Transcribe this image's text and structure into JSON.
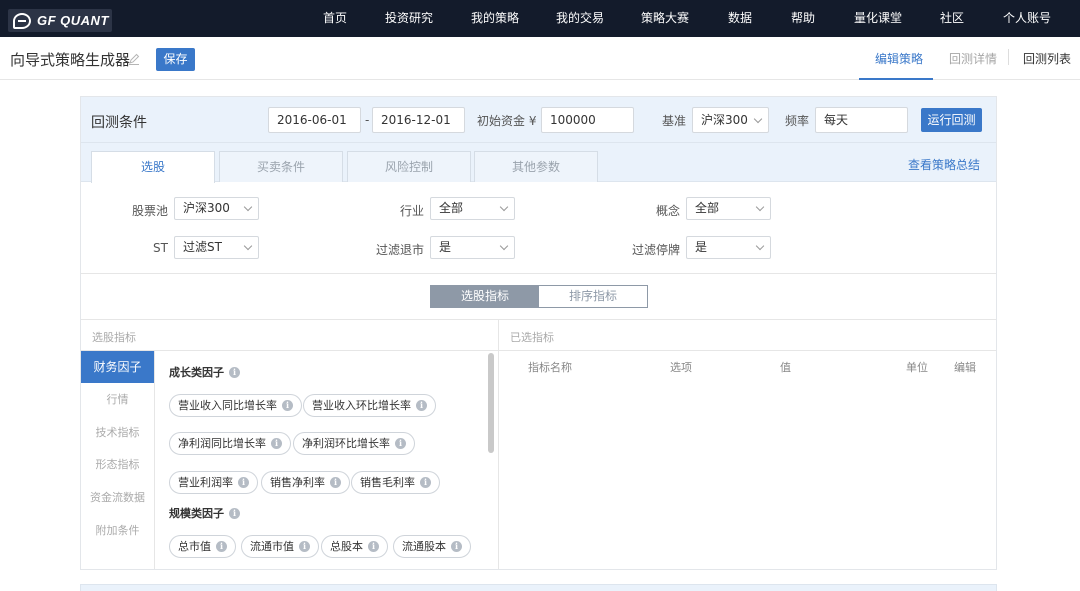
{
  "nav": {
    "logo": "GF QUANT",
    "items": [
      "首页",
      "投资研究",
      "我的策略",
      "我的交易",
      "策略大赛",
      "数据",
      "帮助",
      "量化课堂",
      "社区",
      "个人账号"
    ]
  },
  "header": {
    "title": "向导式策略生成器",
    "save_label": "保存",
    "tabs": [
      "编辑策略",
      "回测详情",
      "回测列表"
    ]
  },
  "backtest": {
    "title": "回测条件",
    "start_date": "2016-06-01",
    "date_sep": "-",
    "end_date": "2016-12-01",
    "capital_label": "初始资金 ¥",
    "capital": "100000",
    "benchmark_label": "基准",
    "benchmark": "沪深300",
    "freq_label": "频率",
    "freq": "每天",
    "run_label": "运行回测"
  },
  "tabs": [
    "选股",
    "买卖条件",
    "风险控制",
    "其他参数"
  ],
  "summary_link": "查看策略总结",
  "filters": {
    "pool_label": "股票池",
    "pool": "沪深300",
    "industry_label": "行业",
    "industry": "全部",
    "concept_label": "概念",
    "concept": "全部",
    "st_label": "ST",
    "st": "过滤ST",
    "delist_label": "过滤退市",
    "delist": "是",
    "suspend_label": "过滤停牌",
    "suspend": "是"
  },
  "toggle": [
    "选股指标",
    "排序指标"
  ],
  "left_section_title": "选股指标",
  "right_section_title": "已选指标",
  "categories": [
    "财务因子",
    "行情",
    "技术指标",
    "形态指标",
    "资金流数据",
    "附加条件"
  ],
  "groups": [
    {
      "title": "成长类因子",
      "items": [
        "营业收入同比增长率",
        "营业收入环比增长率",
        "净利润同比增长率",
        "净利润环比增长率",
        "营业利润率",
        "销售净利率",
        "销售毛利率"
      ]
    },
    {
      "title": "规模类因子",
      "items": [
        "总市值",
        "流通市值",
        "总股本",
        "流通股本"
      ]
    }
  ],
  "selected_columns": [
    "指标名称",
    "选项",
    "值",
    "单位",
    "编辑"
  ],
  "info_glyph": "i",
  "colors": {
    "accent": "#3a78c9",
    "nav_bg": "#131b2b",
    "panel_tint": "#eaf2fb"
  }
}
